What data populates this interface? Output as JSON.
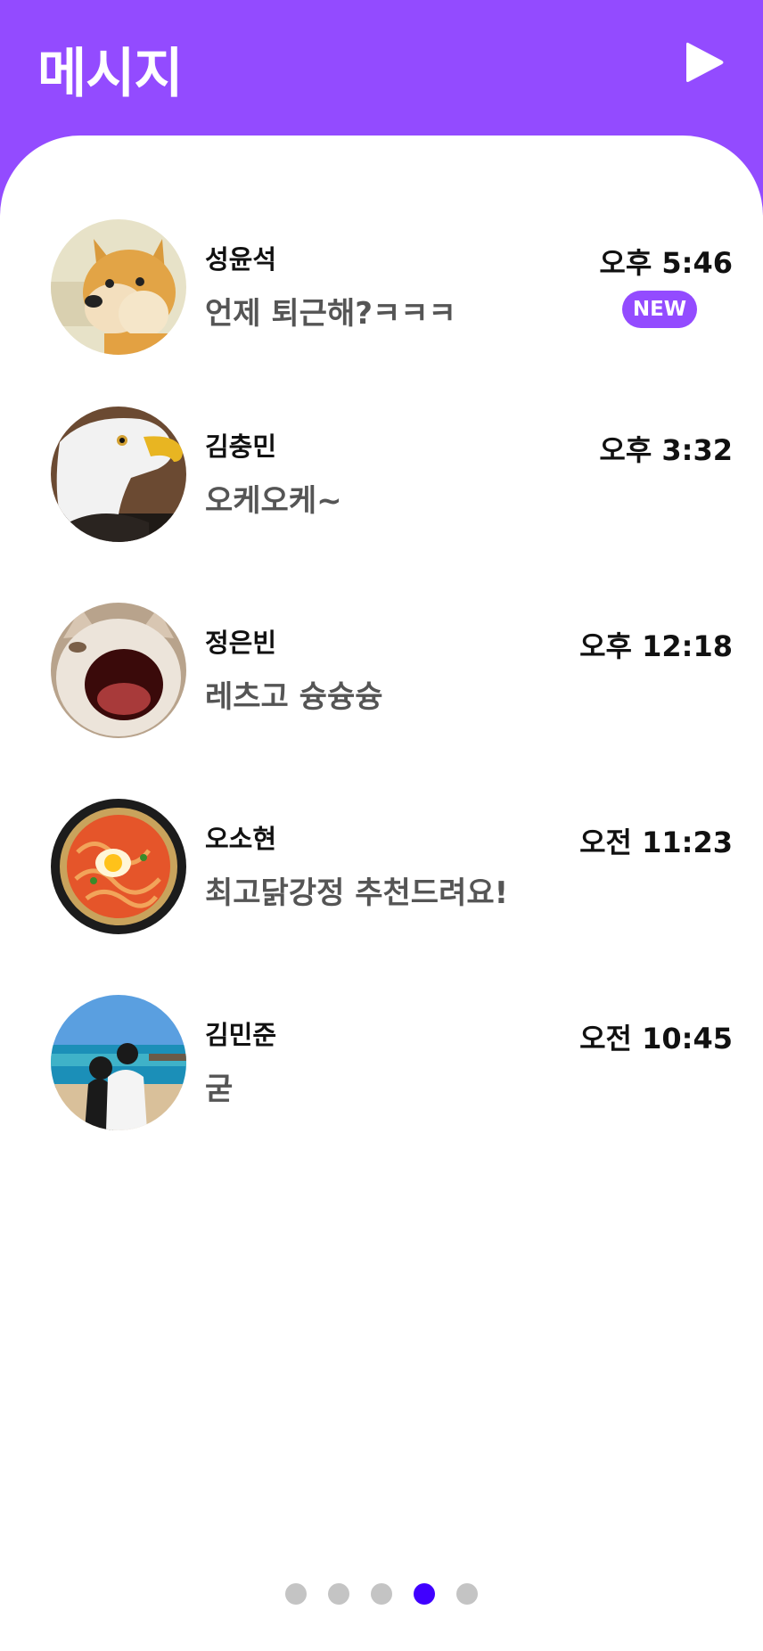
{
  "header": {
    "title": "메시지",
    "play_icon": "play-icon"
  },
  "colors": {
    "brand": "#934bff",
    "badge": "#934bff",
    "active_dot": "#4000ff",
    "inactive_dot": "#c4c4c4"
  },
  "conversations": [
    {
      "name": "성윤석",
      "message": "언제 퇴근해?ㅋㅋㅋ",
      "time": "오후 5:46",
      "badge": "NEW",
      "avatar": "shiba-dog-avatar"
    },
    {
      "name": "김충민",
      "message": "오케오케~",
      "time": "오후 3:32",
      "avatar": "eagle-avatar"
    },
    {
      "name": "정은빈",
      "message": "레츠고 슝슝슝",
      "time": "오후 12:18",
      "avatar": "pop-cat-avatar"
    },
    {
      "name": "오소현",
      "message": "최고닭강정 추천드려요!",
      "time": "오전 11:23",
      "avatar": "ramen-avatar"
    },
    {
      "name": "김민준",
      "message": "굳",
      "time": "오전 10:45",
      "avatar": "couple-beach-avatar"
    }
  ],
  "pagination": {
    "count": 5,
    "active_index": 3
  }
}
